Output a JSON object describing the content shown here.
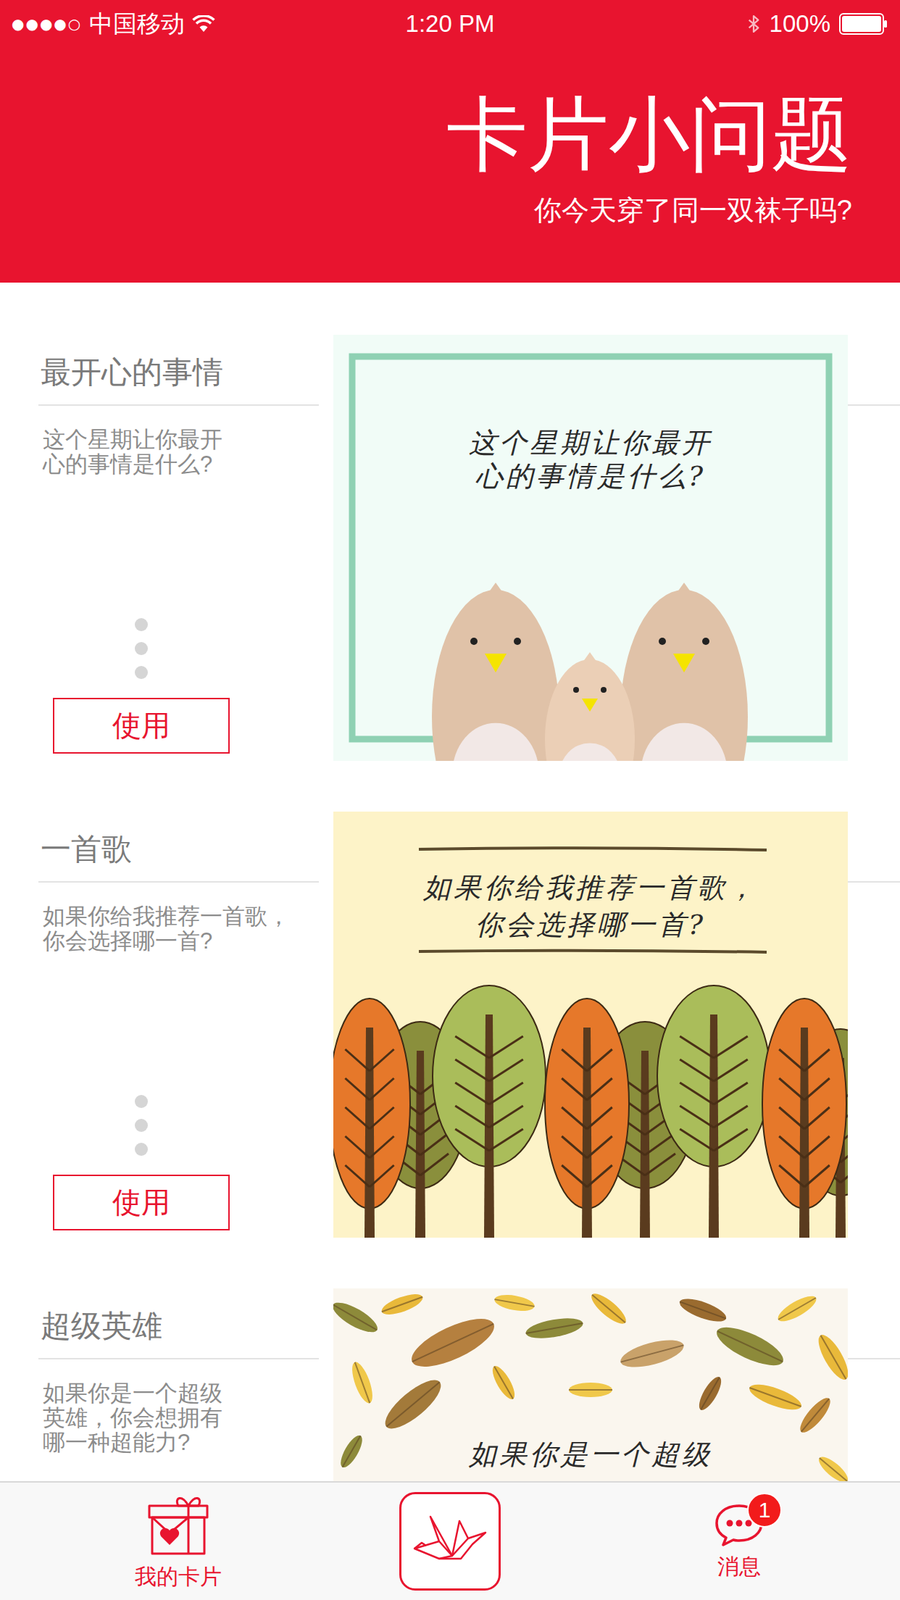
{
  "status_bar": {
    "signal": "●●●●○",
    "carrier": "中国移动",
    "time": "1:20 PM",
    "battery": "100%",
    "battery_level": 1.0
  },
  "header": {
    "title": "卡片小问题",
    "subtitle": "你今天穿了同一双袜子吗?"
  },
  "cards": [
    {
      "title": "最开心的事情",
      "description_lines": [
        "这个星期让你最开",
        "心的事情是什么?"
      ],
      "button": "使用",
      "kind": "birds",
      "image_text": [
        "这个星期让你最开",
        "心的事情是什么?"
      ]
    },
    {
      "title": "一首歌",
      "description_lines": [
        "如果你给我推荐一首歌，",
        "你会选择哪一首?"
      ],
      "button": "使用",
      "kind": "trees",
      "image_text": [
        "如果你给我推荐一首歌，",
        "你会选择哪一首?"
      ]
    },
    {
      "title": "超级英雄",
      "description_lines": [
        "如果你是一个超级",
        "英雄，你会想拥有",
        "哪一种超能力?"
      ],
      "kind": "leaves",
      "image_text": [
        "如果你是一个超级"
      ]
    }
  ],
  "tab_bar": {
    "items": [
      {
        "kind": "gift",
        "label": "我的卡片"
      },
      {
        "kind": "crane"
      },
      {
        "kind": "chat",
        "label": "消息",
        "badge": "1"
      }
    ]
  }
}
